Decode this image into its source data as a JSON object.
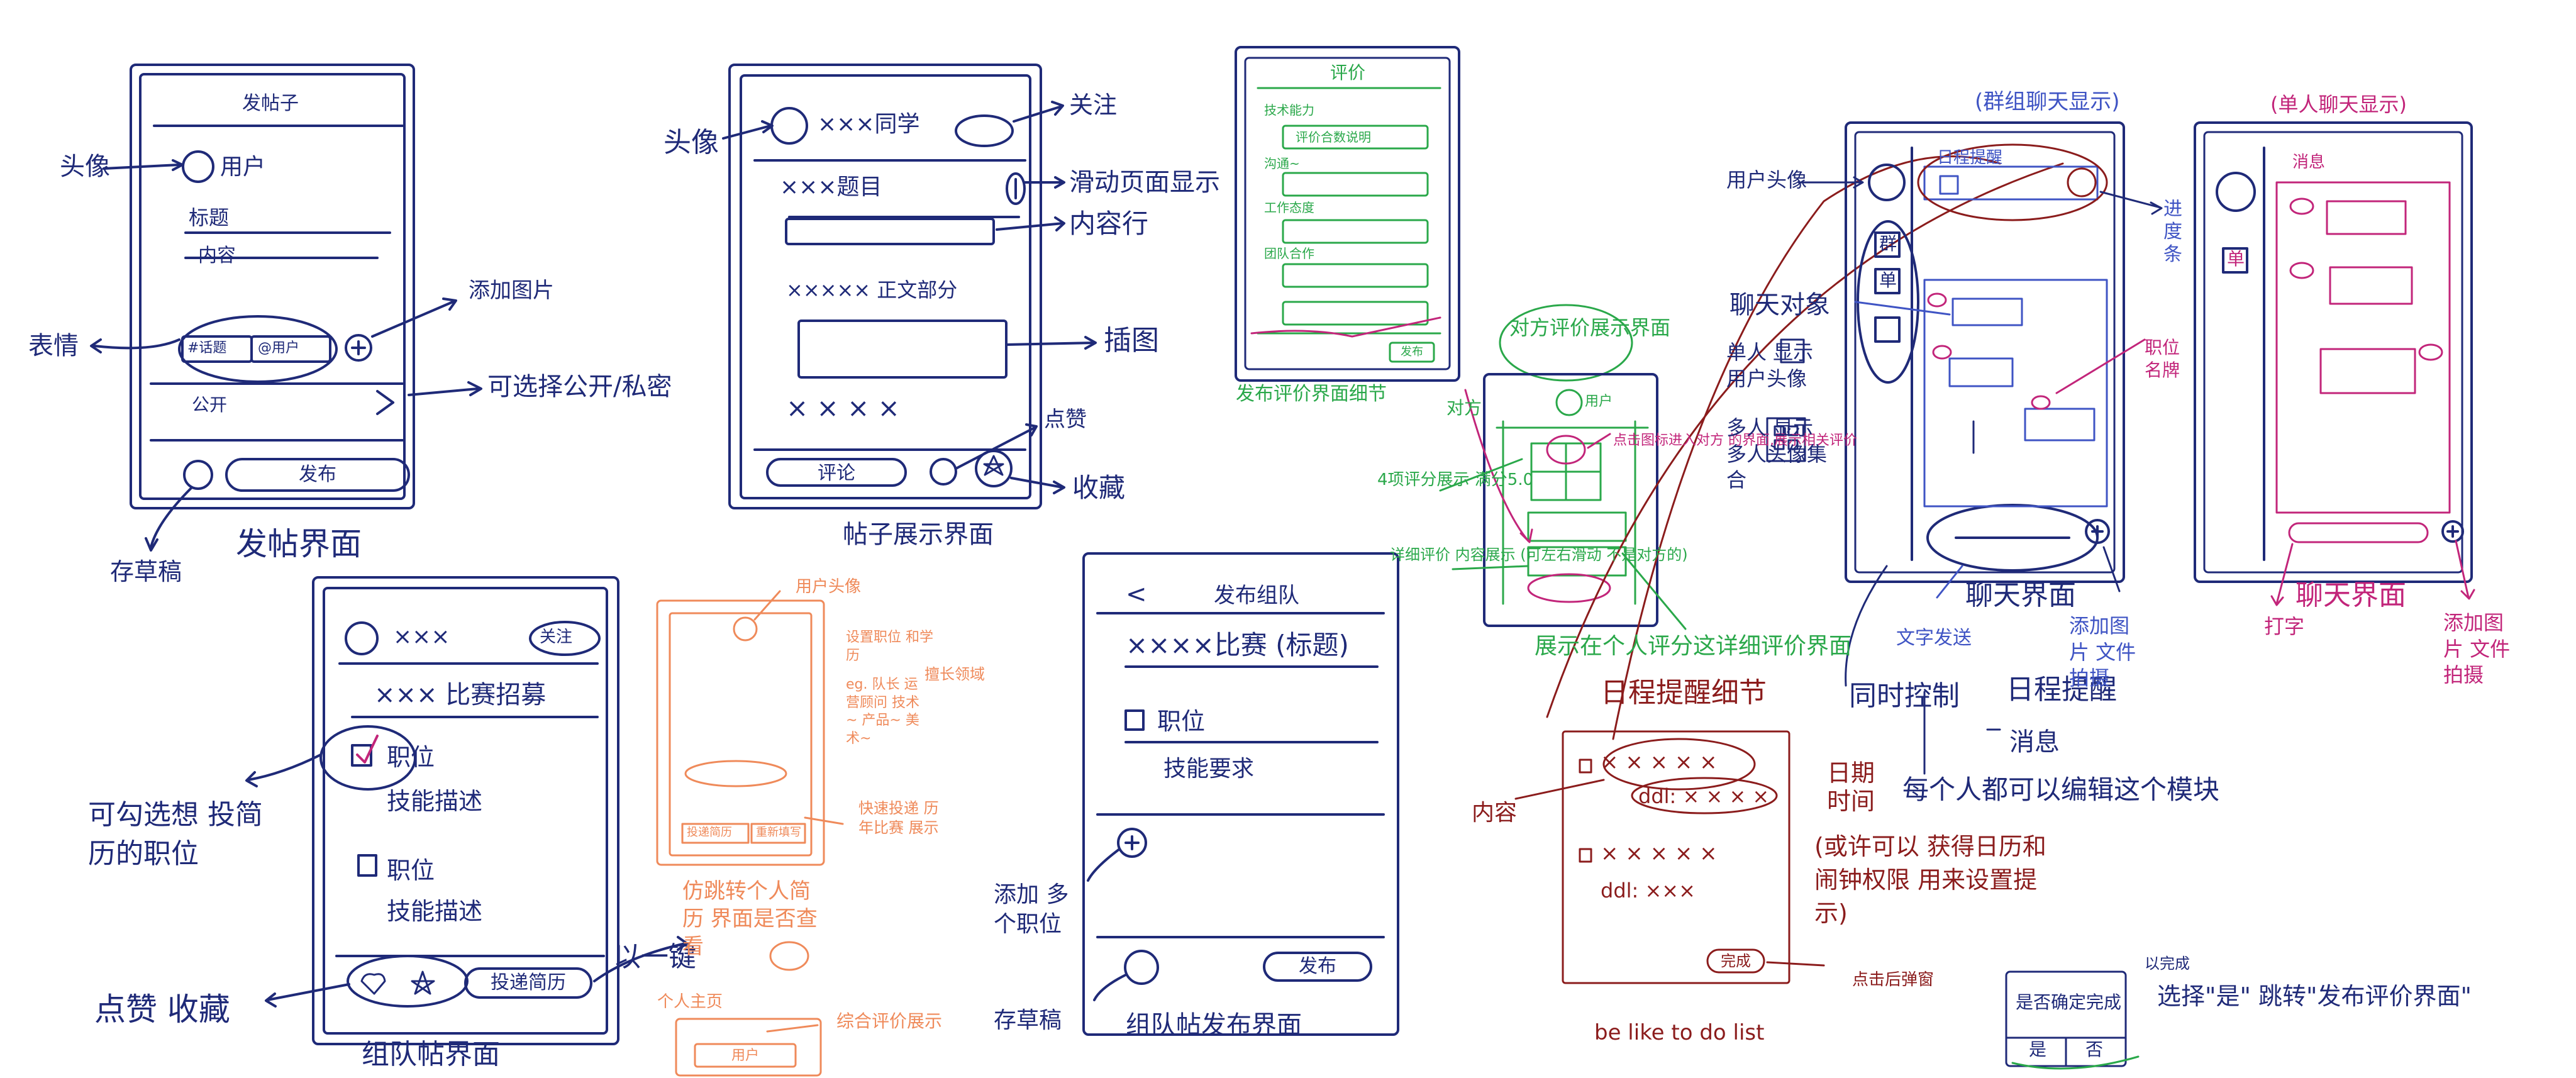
{
  "colors": {
    "navy": "#1f2a78",
    "blue": "#3f54c4",
    "green": "#2aa84a",
    "orange": "#ef8a5a",
    "darkred": "#8b1c1c",
    "magenta": "#c2257a"
  },
  "post_screen": {
    "title": "发帖子",
    "user": "用户",
    "field_title": "标题",
    "field_content": "内容",
    "tag_topic": "#话题",
    "tag_user": "@用户",
    "visibility": "公开",
    "submit": "发布",
    "caption": "发帖界面",
    "note_avatar": "头像",
    "note_add_image": "添加图片",
    "note_expression": "表情",
    "note_visibility": "可选择公开/私密",
    "note_draft": "存草稿"
  },
  "post_display": {
    "header_name": "×××同学",
    "follow_note": "关注",
    "avatar_note": "头像",
    "topic": "×××题目",
    "body": "×××××  正文部分",
    "footer_text": "× × ×  ×",
    "comment_btn": "评论",
    "scroll_note": "滑动页面显示",
    "content_note": "内容行",
    "image_note": "插图",
    "like_note": "点赞",
    "collect_note": "收藏",
    "caption": "帖子展示界面"
  },
  "eval_publish": {
    "title": "评价",
    "rows": [
      "技术能力",
      "评价合数说明",
      "沟通~",
      "工作态度",
      "团队合作"
    ],
    "submit": "发布",
    "caption": "发布评价界面细节"
  },
  "eval_display": {
    "title": "对方评价展示界面",
    "user": "用户",
    "note_score": "4项评分展示 满分5.0",
    "note_detail": "详细评价 内容展示 (可左右滑动 不是对方的)",
    "note_click": "点击图标进入对方 的界面,展示相关评价",
    "note_dui": "对方",
    "caption": "展示在个人评分这详细评价界面"
  },
  "team_recruit": {
    "name": "×××",
    "follow": "关注",
    "competition": "××× 比赛招募",
    "pos1": "职位",
    "desc1": "技能描述",
    "pos2": "职位",
    "desc2": "技能描述",
    "submit_resume": "投递简历",
    "note_check": "可勾选想 投简历的职位",
    "note_like": "点赞  收藏",
    "note_key": "以一键",
    "caption": "组队帖界面"
  },
  "resume_view": {
    "note_avatar": "用户头像",
    "note_settings": "设置职位 和学历",
    "note_skill": "擅长领域",
    "note_etc": "eg. 队长 运营顾问 技术~ 产品~ 美术~",
    "note_quick": "快速投递 历年比赛 展示",
    "note_profile": "个人主页",
    "note_eval": "综合评价展示",
    "note_jump": "仿跳转个人简历 界面是否查看",
    "btn_submit": "投递简历",
    "btn_reset": "重新填写",
    "btn_user": "用户"
  },
  "team_publish": {
    "title": "发布组队",
    "competition": "××××比赛 (标题)",
    "pos": "职位",
    "skill": "技能要求",
    "submit": "发布",
    "note_add": "添加 多个职位",
    "note_draft": "存草稿",
    "caption": "组队帖发布界面"
  },
  "schedule": {
    "title": "日程提醒细节",
    "items": [
      "× × × × ×",
      "ddl:  × × × ×",
      "× × × × ×",
      "ddl:  ×××"
    ],
    "done": "完成",
    "note_content": "内容",
    "note_date": "日期",
    "note_time": "时间",
    "note_edit": "每个人都可以编辑这个模块",
    "note_maybe": "(或许可以 获得日历和闹钟权限 用来设置提示)",
    "note_popup": "点击后弹窗",
    "popup_q": "是否确定完成",
    "popup_yes": "是",
    "popup_no": "否",
    "note_choose": "选择\"是\" 跳转\"发布评价界面\"",
    "note_complete": "以完成",
    "note_todo": "be like  to do list"
  },
  "group_chat": {
    "title": "(群组聊天显示)",
    "header": "日程提醒",
    "tab_group": "群",
    "tab_single": "单",
    "note_avatar": "用户头像",
    "note_progress": "进度条",
    "note_chat_obj": "聊天对象",
    "note_single": "单人 显示用户头像",
    "note_multi": "多人 显示多人头像集合",
    "note_sync": "同时控制",
    "note_schedule": "日程提醒",
    "note_msg": "消息",
    "note_text": "文字发送",
    "note_addimg": "添加图片 文件 拍摄",
    "note_role": "职位 名牌",
    "caption": "聊天界面"
  },
  "single_chat": {
    "title": "(单人聊天显示)",
    "header": "消息",
    "tab_single": "单",
    "note_send": "打字",
    "note_add": "添加图片 文件 拍摄",
    "caption": "聊天界面"
  }
}
